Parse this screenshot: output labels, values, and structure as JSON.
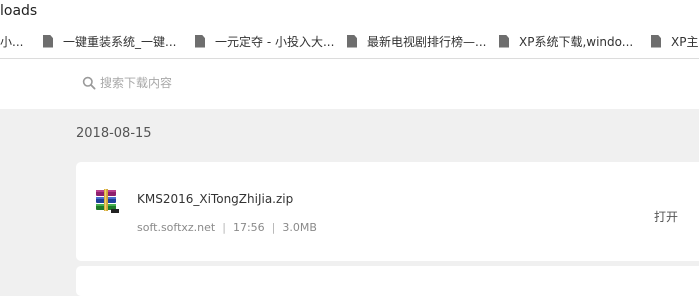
{
  "window": {
    "title": "loads"
  },
  "bookmarks": [
    {
      "label": "小..."
    },
    {
      "label": "一键重装系统_一键..."
    },
    {
      "label": "一元定夺 - 小投入大..."
    },
    {
      "label": "最新电视剧排行榜—..."
    },
    {
      "label": "XP系统下载,windo..."
    },
    {
      "label": "XP主..."
    }
  ],
  "search": {
    "placeholder": "搜索下载内容",
    "value": ""
  },
  "downloads": {
    "date": "2018-08-15",
    "item": {
      "file_name": "KMS2016_XiTongZhiJia.zip",
      "source": "soft.softxz.net",
      "time": "17:56",
      "size": "3.0MB",
      "separator": "|",
      "action": "打开",
      "icon": "winrar-archive-icon"
    }
  }
}
